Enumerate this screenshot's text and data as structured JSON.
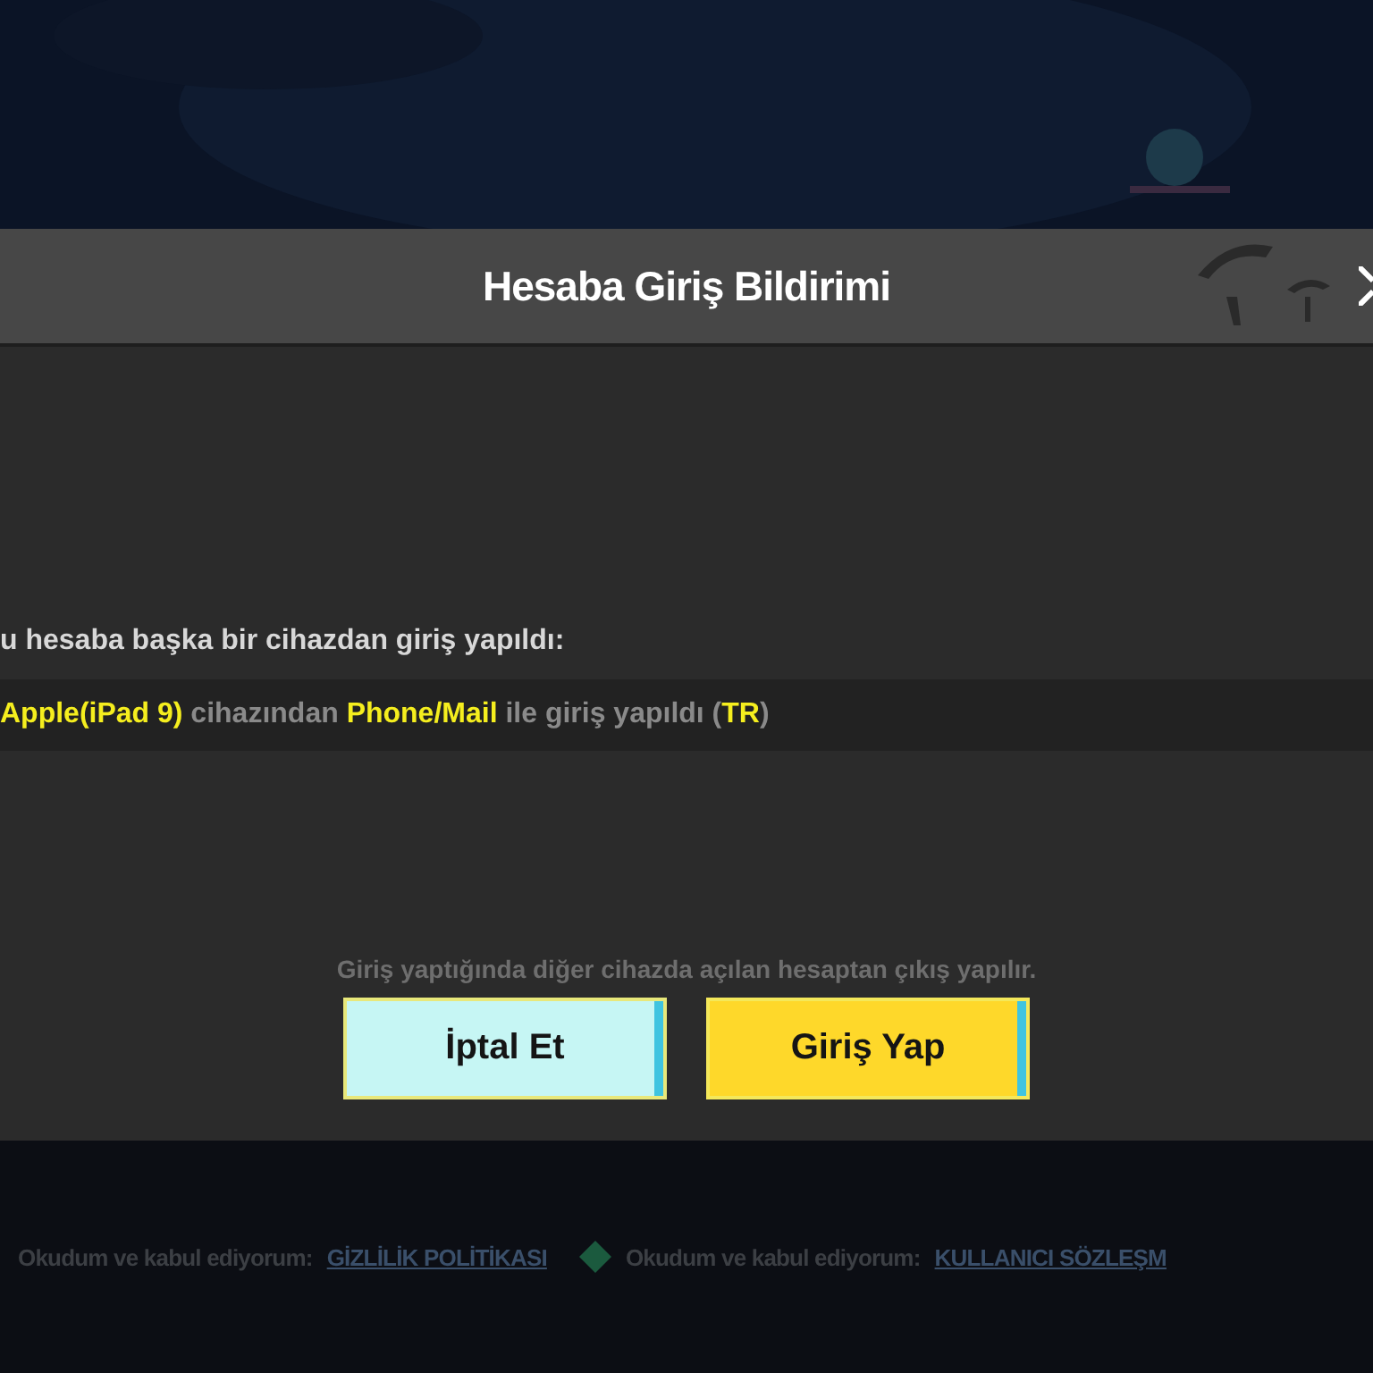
{
  "dialog": {
    "title": "Hesaba Giriş Bildirimi",
    "message": "u hesaba başka bir cihazdan giriş yapıldı:",
    "detail": "**Apple(iPad 9)** cihazından **Phone/Mail** ile giriş yapıldı (**TR**)",
    "note": "Giriş yaptığında diğer cihazda açılan hesaptan çıkış yapılır.",
    "buttons": [
      {
        "label": "İptal Et",
        "kind": "cancel"
      },
      {
        "label": "Giriş Yap",
        "kind": "confirm"
      }
    ]
  },
  "footer": [
    {
      "text": "Okudum ve kabul ediyorum:",
      "link": "GİZLİLİK POLİTİKASI"
    },
    {
      "text": "Okudum ve kabul ediyorum:",
      "link": "KULLANICI SÖZLEŞM"
    }
  ]
}
